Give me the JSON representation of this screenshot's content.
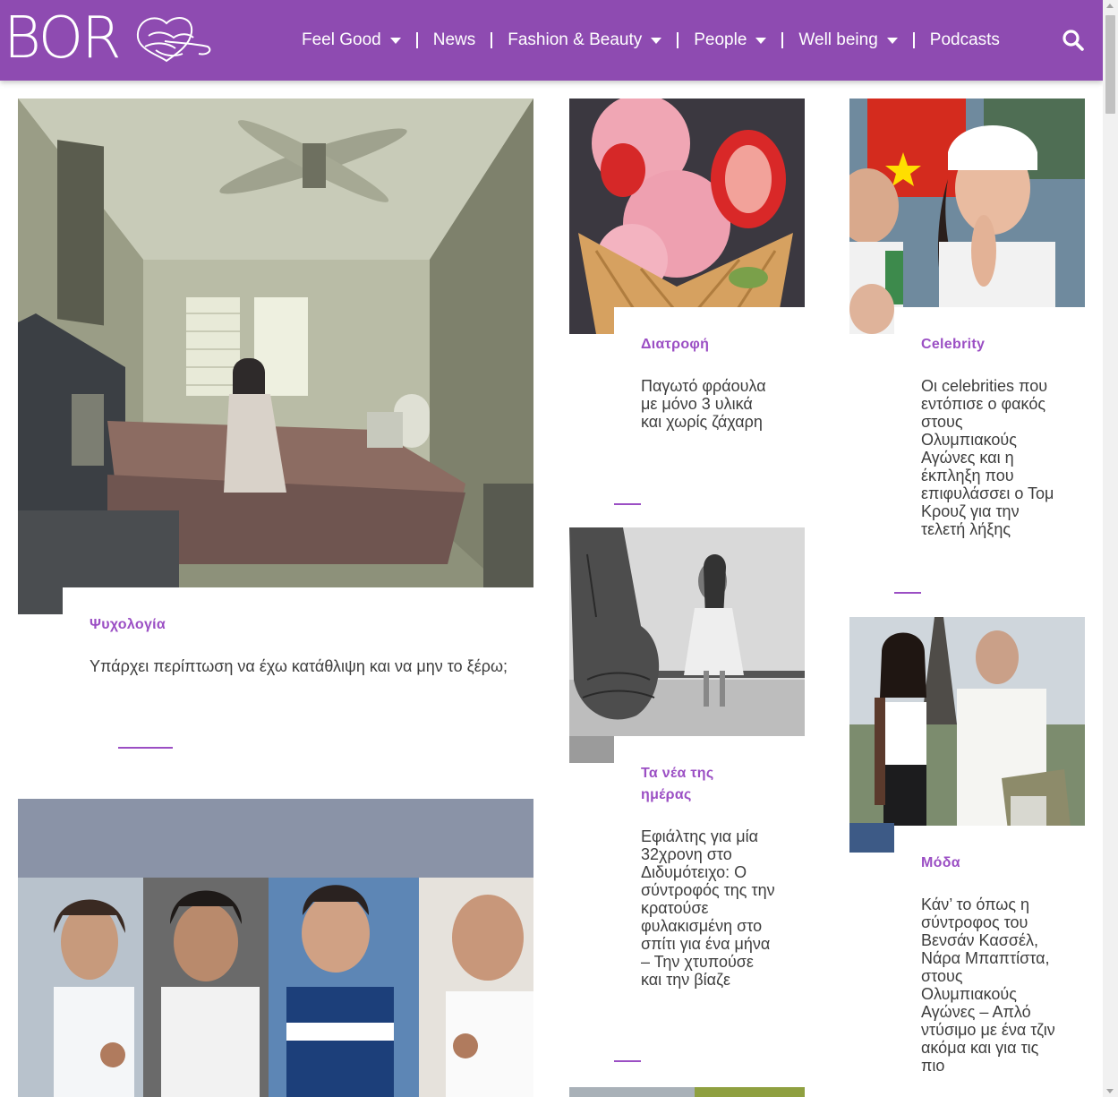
{
  "site": {
    "logo_text": "BOR",
    "brand_color": "#8e4bb1",
    "accent_color": "#9b4fc4"
  },
  "nav": {
    "items": [
      {
        "label": "Feel Good",
        "has_dropdown": true
      },
      {
        "label": "News",
        "has_dropdown": false
      },
      {
        "label": "Fashion & Beauty",
        "has_dropdown": true
      },
      {
        "label": "People",
        "has_dropdown": true
      },
      {
        "label": "Well being",
        "has_dropdown": true
      },
      {
        "label": "Podcasts",
        "has_dropdown": false
      }
    ],
    "search_icon": "search-icon"
  },
  "articles": [
    {
      "category": "Ψυχολογία",
      "title": "Υπάρχει περίπτωση να έχω κατάθλιψη και να μην το ξέρω;"
    },
    {
      "category": "Διατροφή",
      "title": "Παγωτό φράουλα με μόνο 3 υλικά και χωρίς ζάχαρη"
    },
    {
      "category": "Celebrity",
      "title": "Οι celebrities που εντόπισε ο φακός στους Ολυμπιακούς Αγώνες και η έκπληξη που επιφυλάσσει ο Τομ Κρουζ για την τελετή λήξης"
    },
    {
      "category": "Τα νέα της ημέρας",
      "title": "Εφιάλτης για μία 32χρονη στο Διδυμότειχο: Ο σύντροφός της την κρατούσε φυλακισμένη στο σπίτι για ένα μήνα – Την χτυπούσε και την βίαζε"
    },
    {
      "category": "Μόδα",
      "title": "Κάν’ το όπως η σύντροφος του Βενσάν Κασσέλ, Νάρα Μπαπτίστα, στους Ολυμπιακούς Αγώνες – Απλό ντύσιμο με ένα τζιν ακόμα και για τις πιο"
    }
  ]
}
